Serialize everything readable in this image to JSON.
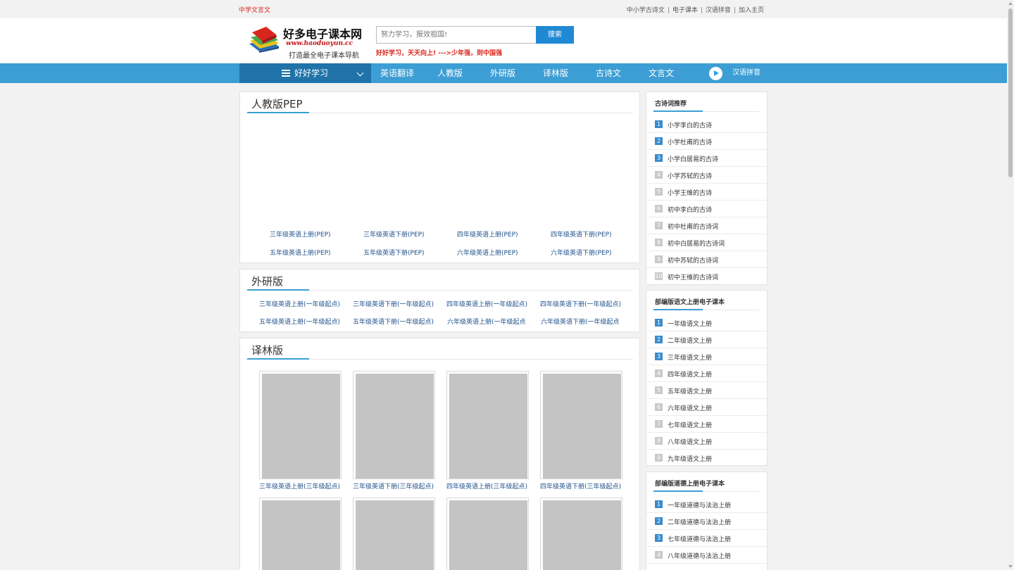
{
  "topbar": {
    "left_link": "中学文言文",
    "right_links": [
      "中小学古诗文",
      "电子课本",
      "汉语拼音",
      "加入主页"
    ]
  },
  "header": {
    "logo_title": "好多电子课本网",
    "logo_url": "www.haoduoyun.cc",
    "logo_slogan": "打造最全电子课本导航",
    "search_placeholder": "努力学习，报效祖国!",
    "search_button": "搜索",
    "motto": "好好学习，天天向上! --->少年强，则中国强"
  },
  "nav": {
    "home_label": "好好学习",
    "items": [
      "英语翻译",
      "人教版",
      "外研版",
      "译林版",
      "古诗文",
      "文言文"
    ],
    "pinyin_label": "汉语拼音",
    "bg_color": "#3c9ed4",
    "home_bg_color": "#1f73a8"
  },
  "pep": {
    "title": "人教版PEP",
    "links": [
      "三年级英语上册(PEP)",
      "三年级英语下册(PEP)",
      "四年级英语上册(PEP)",
      "四年级英语下册(PEP)",
      "五年级英语上册(PEP)",
      "五年级英语下册(PEP)",
      "六年级英语上册(PEP)",
      "六年级英语下册(PEP)"
    ]
  },
  "wy": {
    "title": "外研版",
    "links": [
      "三年级英语上册(一年级起点)",
      "三年级英语下册(一年级起点)",
      "四年级英语上册(一年级起点)",
      "四年级英语下册(一年级起点)",
      "五年级英语上册(一年级起点)",
      "五年级英语下册(一年级起点)",
      "六年级英语上册(一年级起点",
      "六年级英语下册(一年级起点"
    ]
  },
  "yl": {
    "title": "译林版",
    "books": [
      "三年级英语上册(三年级起点)",
      "三年级英语下册(三年级起点)",
      "四年级英语上册(三年级起点)",
      "四年级英语下册(三年级起点)"
    ]
  },
  "sidebar": {
    "poems": {
      "title": "古诗词推荐",
      "items": [
        "小学李白的古诗",
        "小学杜甫的古诗",
        "小学白居易的古诗",
        "小学苏轼的古诗",
        "小学王维的古诗",
        "初中李白的古诗",
        "初中杜甫的古诗词",
        "初中白居易的古诗词",
        "初中苏轼的古诗词",
        "初中王维的古诗词"
      ]
    },
    "chinese": {
      "title": "部编版语文上册电子课本",
      "items": [
        "一年级语文上册",
        "二年级语文上册",
        "三年级语文上册",
        "四年级语文上册",
        "五年级语文上册",
        "六年级语文上册",
        "七年级语文上册",
        "八年级语文上册",
        "九年级语文上册"
      ]
    },
    "moral": {
      "title": "部编版道德上册电子课本",
      "items": [
        "一年级道德与法治上册",
        "二年级道德与法治上册",
        "七年级道德与法治上册",
        "八年级道德与法治上册"
      ]
    }
  }
}
